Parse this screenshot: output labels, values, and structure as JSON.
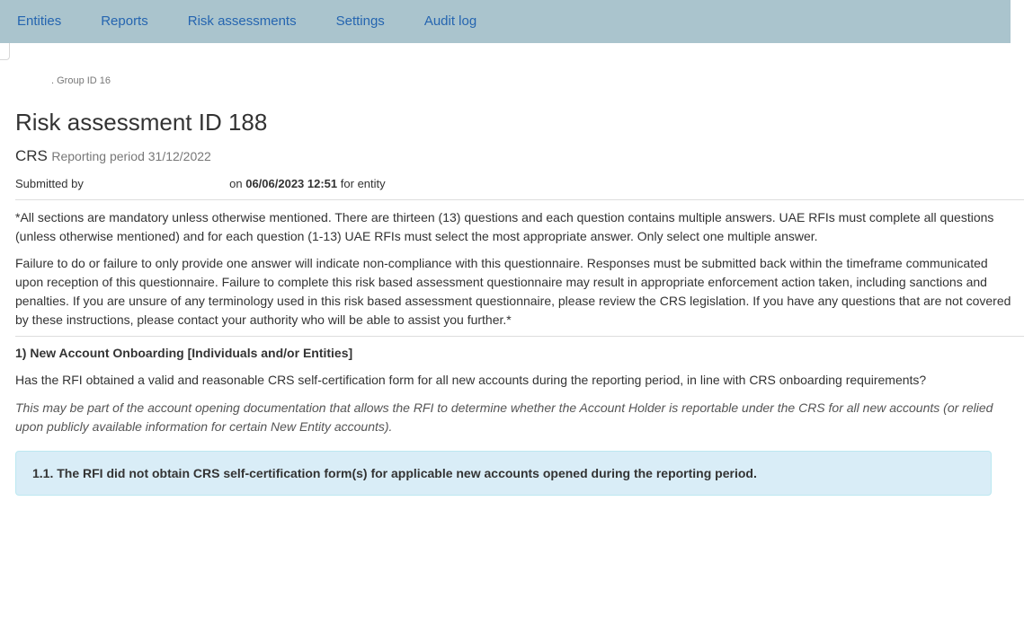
{
  "nav": {
    "items": [
      {
        "label": "Entities"
      },
      {
        "label": "Reports"
      },
      {
        "label": "Risk assessments"
      },
      {
        "label": "Settings"
      },
      {
        "label": "Audit log"
      }
    ]
  },
  "breadcrumb": {
    "text": ". Group ID 16"
  },
  "page": {
    "title": "Risk assessment ID 188",
    "type": "CRS",
    "period": "Reporting period 31/12/2022"
  },
  "submission": {
    "prefix": "Submitted by",
    "on_label": "on",
    "datetime": "06/06/2023 12:51",
    "entity_label": "for entity"
  },
  "instructions": {
    "paragraph1": "*All sections are mandatory unless otherwise mentioned. There are thirteen (13) questions and each question contains multiple answers. UAE RFIs must complete all questions (unless otherwise mentioned) and for each question (1-13) UAE RFIs must select the most appropriate answer. Only select one multiple answer.",
    "paragraph2": "Failure to do or failure to only provide one answer will indicate non-compliance with this questionnaire. Responses must be submitted back within the timeframe communicated upon reception of this questionnaire. Failure to complete this risk based assessment questionnaire may result in appropriate enforcement action taken, including sanctions and penalties. If you are unsure of any terminology used in this risk based assessment questionnaire, please review the CRS legislation. If you have any questions that are not covered by these instructions, please contact your authority who will be able to assist you further.*"
  },
  "section1": {
    "title": "1) New Account Onboarding [Individuals and/or Entities]",
    "question": "Has the RFI obtained a valid and reasonable CRS self-certification form for all new accounts during the reporting period, in line with CRS onboarding requirements?",
    "hint": "This may be part of the account opening documentation that allows the RFI to determine whether the Account Holder is reportable under the CRS for all new accounts (or relied upon publicly available information for certain New Entity accounts).",
    "answer": "1.1. The RFI did not obtain CRS self-certification form(s) for applicable new accounts opened during the reporting period."
  },
  "colors": {
    "navbar_bg": "#aac4cd",
    "nav_link": "#2565b0",
    "answer_bg": "#d9edf7",
    "answer_border": "#bce8f1"
  }
}
